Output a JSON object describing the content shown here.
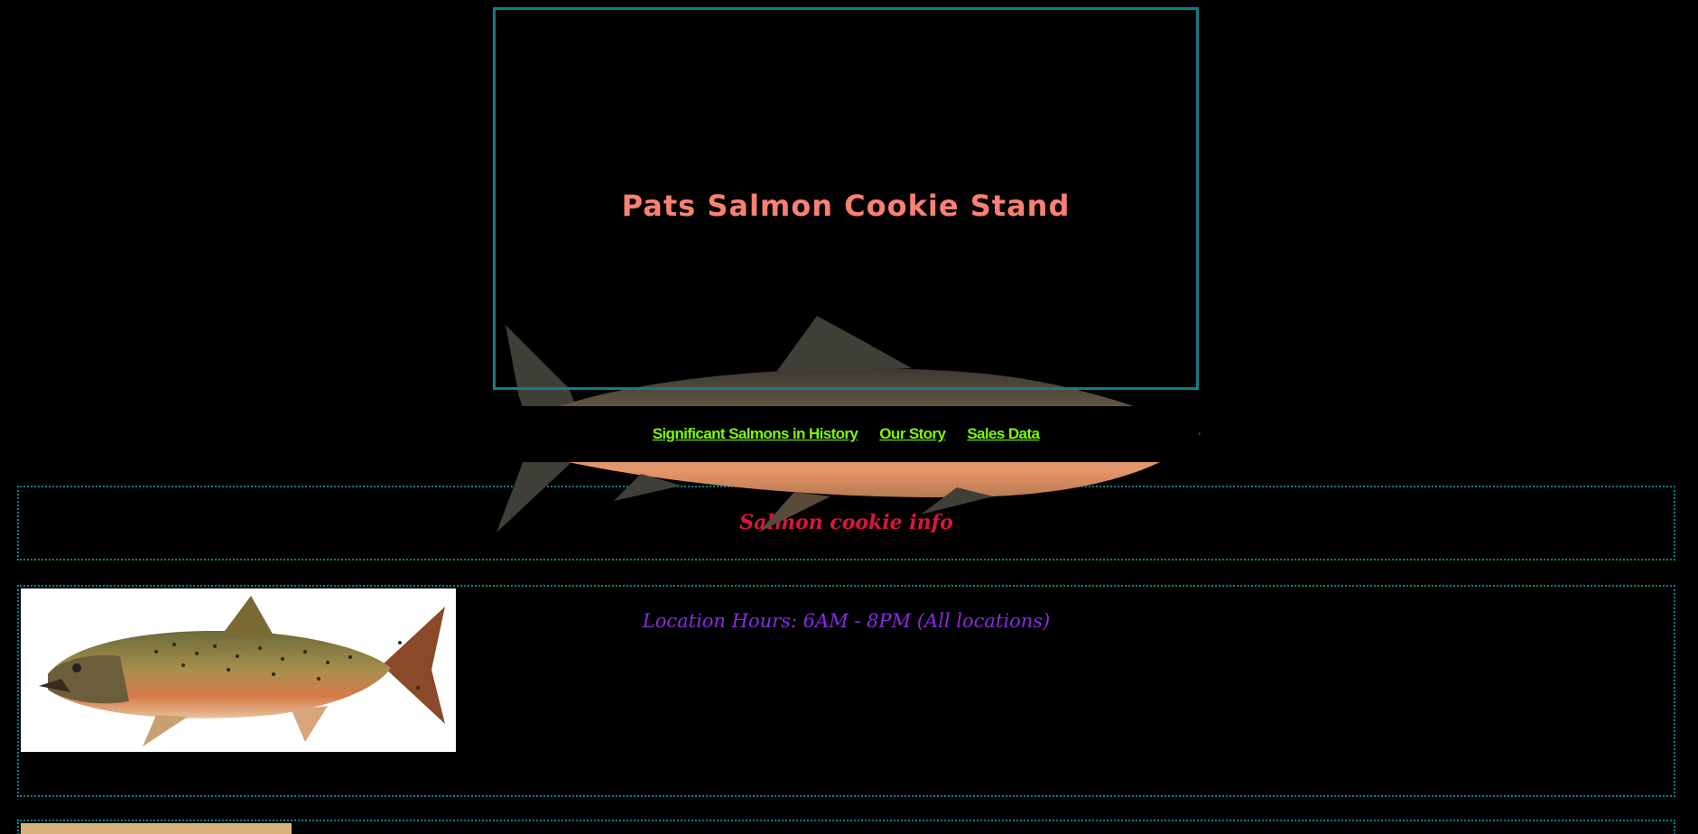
{
  "header": {
    "title": "Pats Salmon Cookie Stand"
  },
  "nav": {
    "links": [
      {
        "label": "Significant Salmons in History"
      },
      {
        "label": "Our Story"
      },
      {
        "label": "Sales Data"
      }
    ]
  },
  "info": {
    "heading": "Salmon cookie info"
  },
  "hours": {
    "text": "Location Hours: 6AM - 8PM (All locations)"
  },
  "colors": {
    "background": "#000000",
    "title": "#fa8072",
    "nav_link": "#7cfc00",
    "border": "#0e7f86",
    "info_heading": "#dc143c",
    "hours_text": "#8a2be2"
  }
}
